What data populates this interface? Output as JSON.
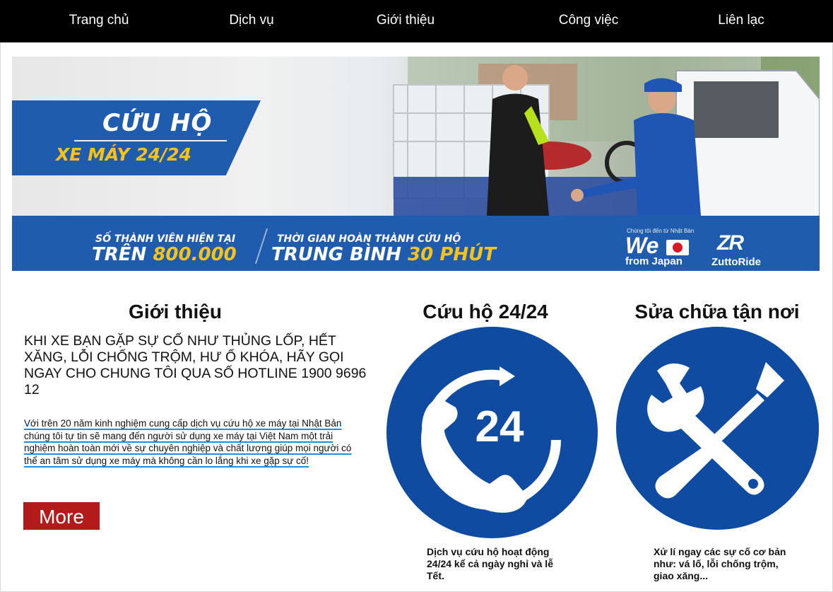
{
  "nav": {
    "items": [
      {
        "label": "Trang chủ"
      },
      {
        "label": "Dịch vụ"
      },
      {
        "label": "Giới thiệu"
      },
      {
        "label": "Công việc"
      },
      {
        "label": "Liên lạc"
      }
    ]
  },
  "banner": {
    "title": "CỨU HỘ",
    "subtitle": "XE MÁY 24/24",
    "stat1_small": "SỐ THÀNH VIÊN HIỆN TẠI",
    "stat1_big_prefix": "TRÊN",
    "stat1_big_value": "800.000",
    "stat2_small": "THỜI GIAN HOÀN THÀNH CỨU HỘ",
    "stat2_big_prefix": "TRUNG BÌNH",
    "stat2_big_value": "30 PHÚT",
    "we_small": "Chúng tôi đến từ Nhật Bản",
    "we_big": "We",
    "we_from": "from Japan",
    "brand_logo": "ZR",
    "brand_name": "ZuttoRide"
  },
  "intro": {
    "heading": "Giới thiệu",
    "caps_text": "KHI XE BẠN GẶP SỰ CỐ NHƯ THỦNG LỐP, HẾT XĂNG, LỖI CHỐNG TRỘM, HƯ Ổ KHÓA, HÃY GỌI NGAY CHO CHUNG TÔI QUA SỐ HOTLINE 1900 9696 12",
    "body_text": "Với trên 20 năm kinh nghiệm cung cấp dịch vụ cứu hộ xe máy tại Nhật Bản chúng tôi tự tin sẽ mang đến người sử dụng xe máy tại Việt Nam một trải nghiệm hoàn toàn mới về sự chuyên nghiệp và chất lượng giúp mọi người có thể an tâm sử dụng xe máy mà không cần lo lắng khi xe gặp sự cố!",
    "more_label": "More"
  },
  "services": [
    {
      "heading": "Cứu hộ 24/24",
      "icon_text": "24",
      "caption": "Dịch vụ cứu hộ hoạt động 24/24 kể cả ngày nghỉ và lễ Tết."
    },
    {
      "heading": "Sửa chữa tận nơi",
      "caption": "Xử lí ngay các sự cố cơ bản như: vá lố, lỗi chống trộm, giao xăng..."
    }
  ],
  "colors": {
    "nav_bg": "#000000",
    "brand_blue": "#0f4ca1",
    "accent_yellow": "#f7c21b",
    "more_red": "#b31b1b",
    "underline_blue": "#1e8fe0"
  }
}
